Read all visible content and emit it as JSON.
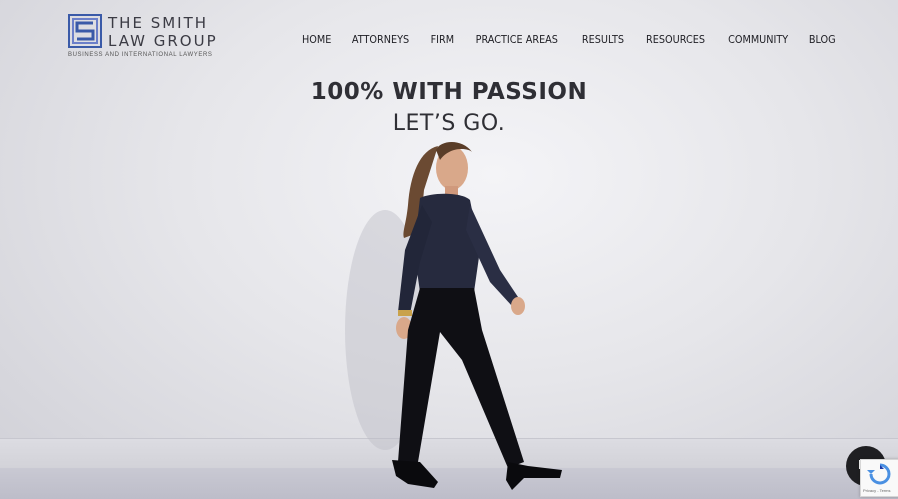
{
  "header": {
    "logo": {
      "line1": "THE SMITH",
      "line2": "LAW GROUP",
      "tagline": "BUSINESS AND INTERNATIONAL LAWYERS",
      "icon": "square-maze-logo-icon"
    },
    "nav": [
      {
        "label": "HOME"
      },
      {
        "label": "ATTORNEYS"
      },
      {
        "label": "FIRM"
      },
      {
        "label": "PRACTICE AREAS"
      },
      {
        "label": "RESULTS"
      },
      {
        "label": "RESOURCES"
      },
      {
        "label": "COMMUNITY"
      },
      {
        "label": "BLOG"
      }
    ]
  },
  "hero": {
    "headline": "100% WITH PASSION",
    "subhead": "LET’S GO.",
    "image": "woman-walking-photo"
  },
  "widgets": {
    "chat_icon": "chat-bubble-icon",
    "recaptcha_text": "Privacy - Terms",
    "recaptcha_icon": "recaptcha-icon"
  },
  "colors": {
    "logo_blue": "#3a5aa8",
    "text_dark": "#2f2f35",
    "background": "#e6e6ea"
  }
}
